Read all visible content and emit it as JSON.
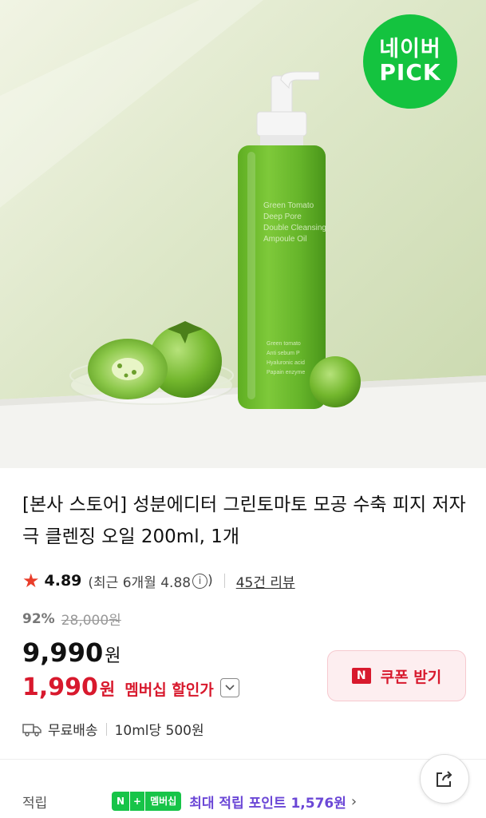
{
  "hero": {
    "badge_line1": "네이버",
    "badge_line2": "PICK",
    "bottle_label_lines": [
      "Green Tomato",
      "Deep Pore",
      "Double Cleansing",
      "Ampoule Oil"
    ],
    "bottle_features": [
      "Green tomato",
      "Anti sebum P",
      "Hyaluronic acid",
      "Papain enzyme"
    ]
  },
  "product": {
    "title": "[본사 스토어] 성분에디터 그린토마토 모공 수축 피지 저자극 클렌징 오일 200ml, 1개",
    "rating": "4.89",
    "recent_rating": "(최근 6개월 4.88",
    "recent_close": ")",
    "info_icon": "i",
    "review_count": "45건 리뷰",
    "discount_rate": "92%",
    "original_price": "28,000원",
    "price": "9,990",
    "price_unit": "원",
    "member_price": "1,990",
    "member_price_unit": "원",
    "member_label": "멤버십 할인가",
    "coupon_icon": "N",
    "coupon_label": "쿠폰 받기",
    "shipping": "무료배송",
    "unit_price": "10ml당 500원",
    "reward_label": "적립",
    "nplus_n": "N",
    "nplus_plus": "+",
    "nplus_member": "멤버십",
    "reward_text": "최대 적립 포인트 1,576원",
    "reward_chevron": "›"
  },
  "colors": {
    "accent_red": "#d8192d",
    "naver_green": "#14c33f",
    "reward_purple": "#6b47d6"
  }
}
